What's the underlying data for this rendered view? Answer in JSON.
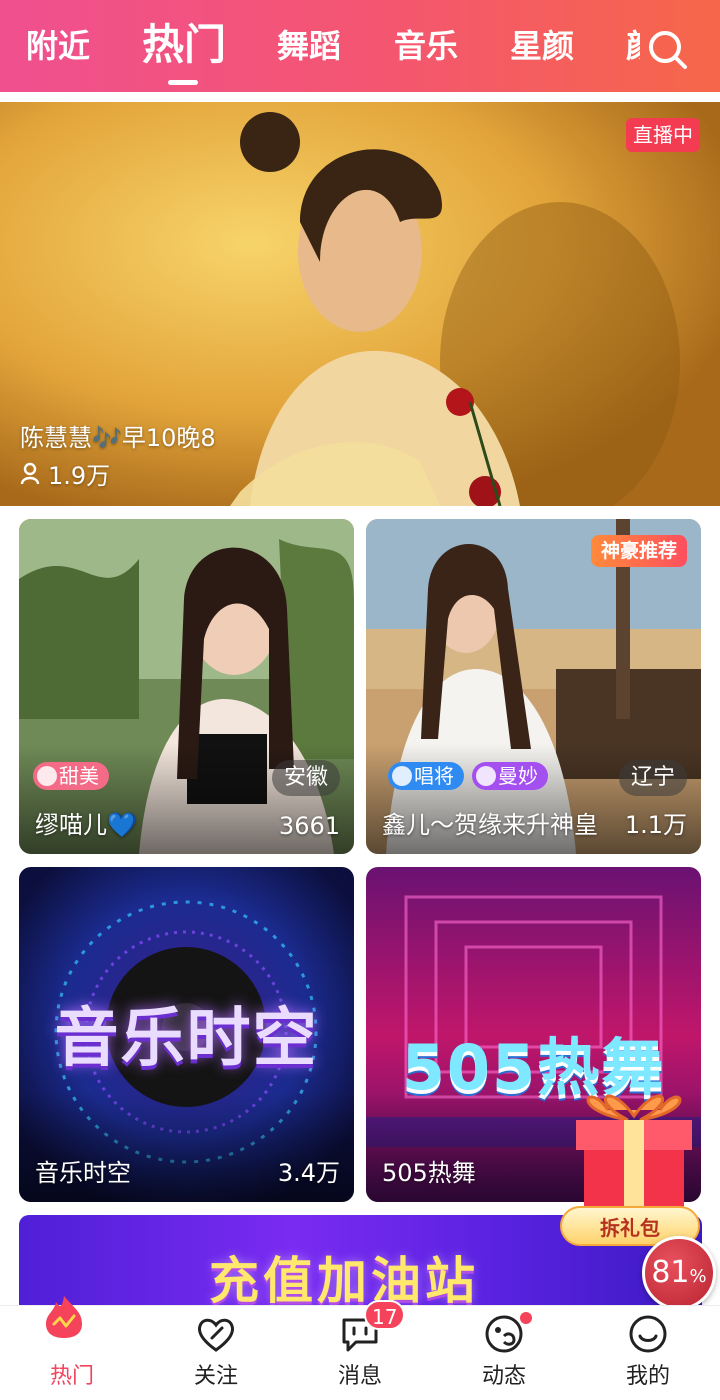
{
  "header": {
    "tabs": [
      "附近",
      "热门",
      "舞蹈",
      "音乐",
      "星颜",
      "颜"
    ],
    "active_tab": "热门",
    "search_icon": "search-icon"
  },
  "hero": {
    "badge": "直播中",
    "title": "陈慧慧🎶早10晚8",
    "viewers": "1.9万",
    "viewer_icon": "person-icon"
  },
  "cards": [
    {
      "name": "缪喵儿💙",
      "count": "3661",
      "location": "安徽",
      "tags": [
        "甜美"
      ]
    },
    {
      "name": "鑫儿～贺缘来升神皇",
      "count": "1.1万",
      "location": "辽宁",
      "tags": [
        "唱将",
        "曼妙"
      ],
      "badge": "神豪推荐"
    },
    {
      "name": "音乐时空",
      "count": "3.4万",
      "banner_text": "音乐时空"
    },
    {
      "name": "505热舞",
      "banner_text": "505热舞"
    }
  ],
  "recharge_banner": {
    "text": "充值加油站"
  },
  "gift": {
    "label": "拆礼包",
    "progress": "81",
    "progress_unit": "%"
  },
  "bottom_nav": {
    "items": [
      {
        "label": "热门",
        "icon": "hot-live-icon",
        "active": true
      },
      {
        "label": "关注",
        "icon": "heart-icon"
      },
      {
        "label": "消息",
        "icon": "message-icon",
        "badge": "17"
      },
      {
        "label": "动态",
        "icon": "moments-icon",
        "dot": true
      },
      {
        "label": "我的",
        "icon": "smile-profile-icon"
      }
    ]
  },
  "colors": {
    "accent": "#f0455f",
    "header_start": "#f0508f",
    "header_end": "#f66749"
  }
}
